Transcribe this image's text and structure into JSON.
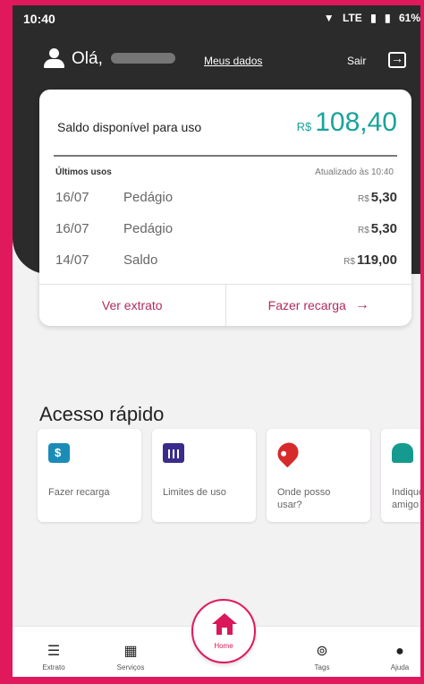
{
  "status": {
    "time": "10:40",
    "network": "LTE",
    "battery": "61%"
  },
  "header": {
    "greeting": "Olá,",
    "my_data": "Meus dados",
    "logout": "Sair"
  },
  "balance_card": {
    "label": "Saldo disponível para uso",
    "currency": "R$",
    "amount": "108,40",
    "uses_title": "Últimos usos",
    "updated": "Atualizado às 10:40",
    "rows": [
      {
        "date": "16/07",
        "desc": "Pedágio",
        "amount": "5,30"
      },
      {
        "date": "16/07",
        "desc": "Pedágio",
        "amount": "5,30"
      },
      {
        "date": "14/07",
        "desc": "Saldo",
        "amount": "119,00"
      }
    ],
    "actions": {
      "statement": "Ver extrato",
      "recharge": "Fazer recarga"
    }
  },
  "quick_access": {
    "title": "Acesso rápido",
    "items": [
      {
        "label": "Fazer recarga",
        "icon": "recharge-icon"
      },
      {
        "label": "Limites de uso",
        "icon": "limits-icon"
      },
      {
        "label": "Onde posso usar?",
        "icon": "location-pin-icon"
      },
      {
        "label": "Indique amigo",
        "icon": "invite-friend-icon"
      }
    ]
  },
  "bottom_nav": {
    "items": [
      "Extrato",
      "Serviços",
      "Home",
      "Tags",
      "Ajuda"
    ]
  },
  "colors": {
    "accent": "#e0195c",
    "balance": "#18a39a",
    "link": "#b22a5d",
    "header_bg": "#2b2b2b"
  }
}
